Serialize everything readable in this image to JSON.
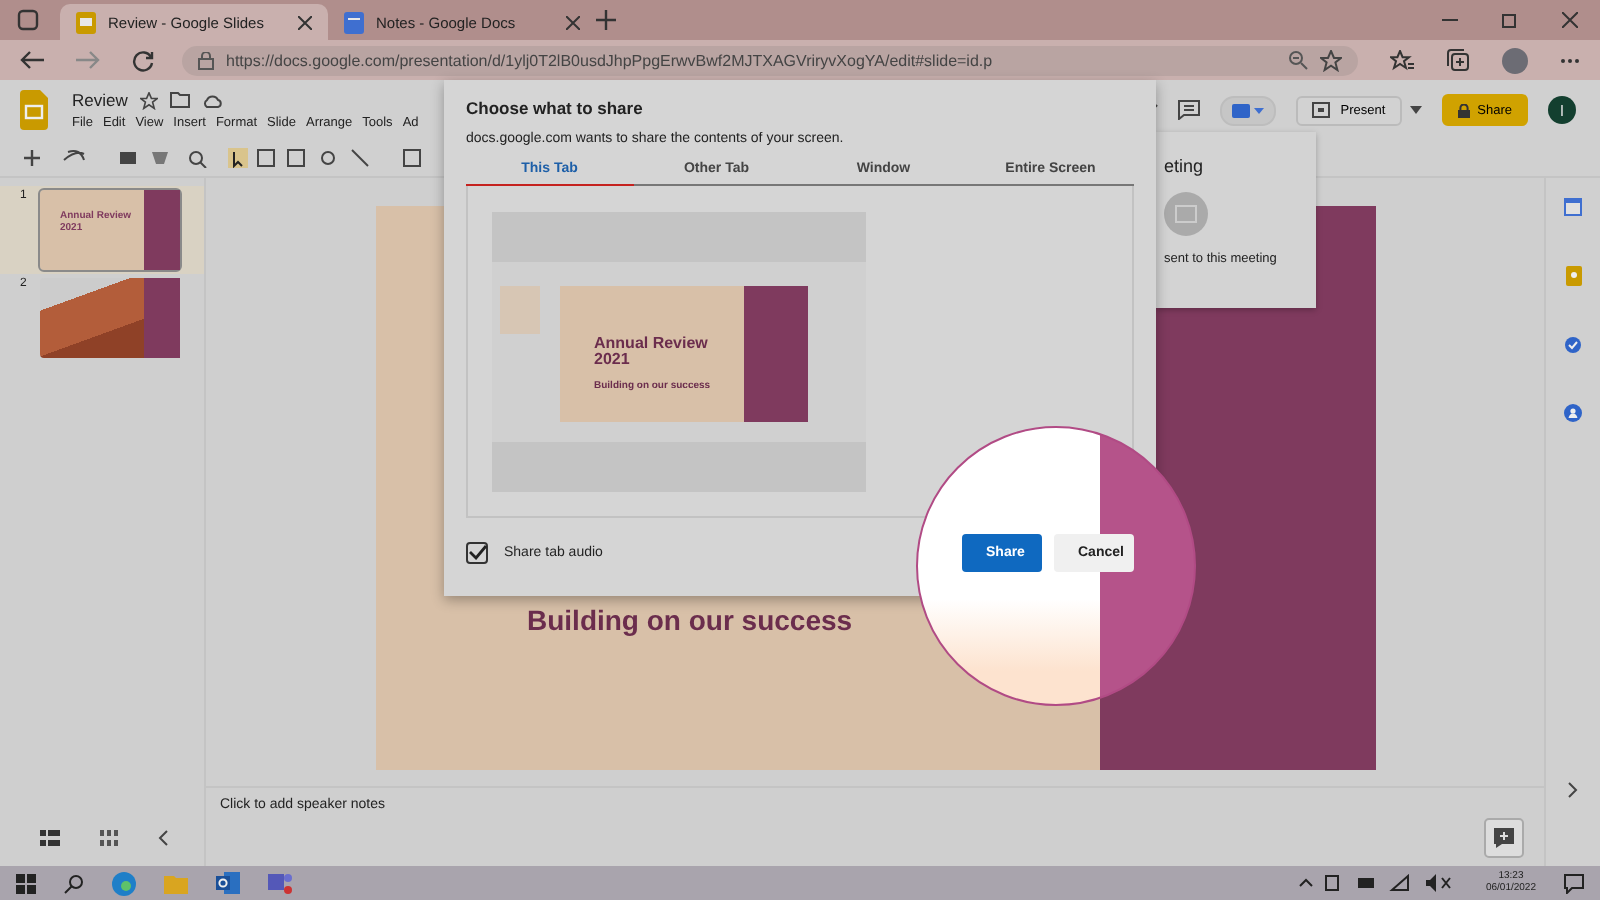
{
  "browser": {
    "tabs": [
      {
        "title": "Review - Google Slides",
        "selected": true,
        "kind": "slides"
      },
      {
        "title": "Notes - Google Docs",
        "selected": false,
        "kind": "docs"
      }
    ],
    "url": "https://docs.google.com/presentation/d/1ylj0T2lB0usdJhpPpgErwvBwf2MJTXAGVriryvXogYA/edit#slide=id.p"
  },
  "doc": {
    "title": "Review",
    "menu": [
      "File",
      "Edit",
      "View",
      "Insert",
      "Format",
      "Slide",
      "Arrange",
      "Tools",
      "Ad"
    ],
    "present_label": "Present",
    "share_label": "Share",
    "avatar_initial": "I"
  },
  "slides_panel": [
    {
      "number": "1",
      "selected": true,
      "kind": "title",
      "title": "Annual Review 2021"
    },
    {
      "number": "2",
      "selected": false,
      "kind": "photo"
    }
  ],
  "slide": {
    "subtitle": "Building on our success"
  },
  "meeting_popup": {
    "heading": "eting",
    "text": "sent to this meeting"
  },
  "speaker_notes": {
    "placeholder": "Click to add speaker notes"
  },
  "dialog": {
    "title": "Choose what to share",
    "message": "docs.google.com wants to share the contents of your screen.",
    "tabs": [
      {
        "label": "This Tab",
        "selected": true
      },
      {
        "label": "Other Tab",
        "selected": false
      },
      {
        "label": "Window",
        "selected": false
      },
      {
        "label": "Entire Screen",
        "selected": false
      }
    ],
    "preview": {
      "title": "Annual Review 2021",
      "subtitle": "Building on our success"
    },
    "audio": {
      "label": "Share tab audio",
      "checked": true
    },
    "buttons": [
      {
        "label": "Share",
        "kind": "primary"
      },
      {
        "label": "Cancel",
        "kind": "secondary"
      }
    ]
  },
  "taskbar": {
    "time": "13:23",
    "date": "06/01/2022"
  }
}
